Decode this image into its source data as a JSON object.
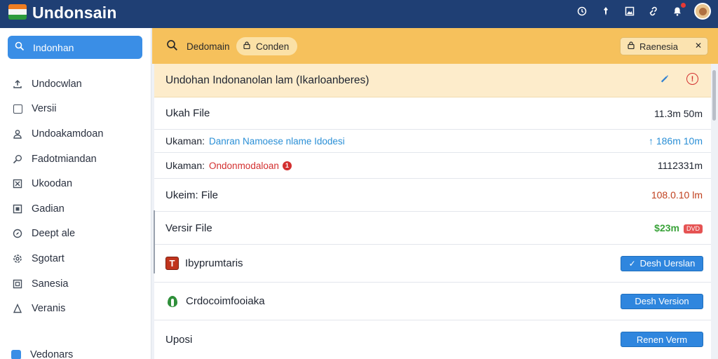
{
  "app": {
    "title": "Undonsain"
  },
  "top_icons": [
    "clock-icon",
    "pin-icon",
    "image-icon",
    "link-icon",
    "bell-icon"
  ],
  "sidebar": {
    "search_label": "Indonhan",
    "items": [
      {
        "label": "Undocwlan",
        "icon": "upload-icon"
      },
      {
        "label": "Versii",
        "icon": "square-icon"
      },
      {
        "label": "Undoakamdoan",
        "icon": "user-icon"
      },
      {
        "label": "Fadotmiandan",
        "icon": "search-icon"
      },
      {
        "label": "Ukoodan",
        "icon": "close-box-icon"
      },
      {
        "label": "Gadian",
        "icon": "grid-icon"
      },
      {
        "label": "Deept ale",
        "icon": "compass-icon"
      },
      {
        "label": "Sgotart",
        "icon": "settings-icon"
      },
      {
        "label": "Sanesia",
        "icon": "expand-icon"
      },
      {
        "label": "Veranis",
        "icon": "person-icon"
      }
    ],
    "bottom_label": "Vedonars"
  },
  "toolbar": {
    "search_label": "Dedomain",
    "chip_label": "Conden",
    "select_label": "Raenesia"
  },
  "panel": {
    "header_title": "Undohan Indonanolan lam (Ikarloanberes)",
    "rows": {
      "r1": {
        "label": "Ukah File",
        "value": "11.3m 50m"
      },
      "r2": {
        "label": "Ukaman:",
        "link": "Danran Namoese nlame Idodesi",
        "value": "↑ 186m 10m"
      },
      "r3": {
        "label": "Ukaman:",
        "link": "Ondonmodaloan",
        "badge": "1",
        "value": "1112331m"
      },
      "r4": {
        "label": "Ukeim: File",
        "value": "108.0.10 lm"
      },
      "r5": {
        "label": "Versir File",
        "value": "$23m",
        "badge": "DVD"
      },
      "r6": {
        "label": "Ibyprumtaris",
        "button": "Desh Uerslan"
      },
      "r7": {
        "label": "Crdocoimfooiaka",
        "button": "Desh Version"
      },
      "r8": {
        "label": "Uposi",
        "button": "Renen Verm"
      }
    }
  },
  "colors": {
    "topbar": "#1f3f74",
    "accent": "#3a8ee6",
    "toolbar": "#f6c15c",
    "header": "#fdeccb",
    "link_blue": "#2a8fd6",
    "alert_red": "#d33030",
    "value_green": "#3aa33a"
  }
}
